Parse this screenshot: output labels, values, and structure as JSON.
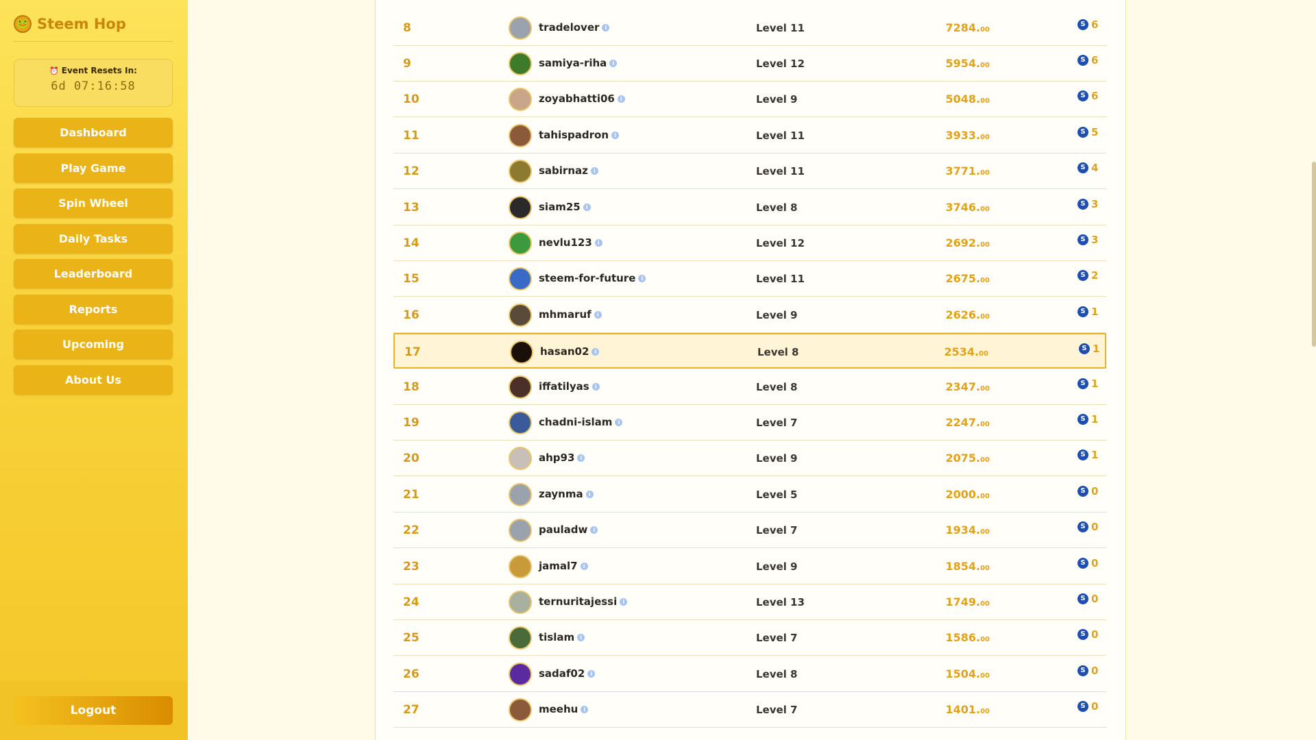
{
  "app": {
    "name": "Steem Hop"
  },
  "timer": {
    "label": "Event Resets In:",
    "value": "6d 07:16:58"
  },
  "nav": [
    {
      "label": "Dashboard"
    },
    {
      "label": "Play Game"
    },
    {
      "label": "Spin Wheel"
    },
    {
      "label": "Daily Tasks"
    },
    {
      "label": "Leaderboard"
    },
    {
      "label": "Reports"
    },
    {
      "label": "Upcoming"
    },
    {
      "label": "About Us"
    }
  ],
  "logout": "Logout",
  "leaderboard": {
    "rows": [
      {
        "rank": "8",
        "user": "tradelover",
        "level": "Level 11",
        "score": "7284.",
        "dec": "00",
        "steem": "6",
        "avatar": "#9aa3ad"
      },
      {
        "rank": "9",
        "user": "samiya-riha",
        "level": "Level 12",
        "score": "5954.",
        "dec": "00",
        "steem": "6",
        "avatar": "#3d7a2a"
      },
      {
        "rank": "10",
        "user": "zoyabhatti06",
        "level": "Level 9",
        "score": "5048.",
        "dec": "00",
        "steem": "6",
        "avatar": "#c9a58a"
      },
      {
        "rank": "11",
        "user": "tahispadron",
        "level": "Level 11",
        "score": "3933.",
        "dec": "00",
        "steem": "5",
        "avatar": "#8a5a3a"
      },
      {
        "rank": "12",
        "user": "sabirnaz",
        "level": "Level 11",
        "score": "3771.",
        "dec": "00",
        "steem": "4",
        "avatar": "#8b7a30"
      },
      {
        "rank": "13",
        "user": "siam25",
        "level": "Level 8",
        "score": "3746.",
        "dec": "00",
        "steem": "3",
        "avatar": "#2a2a2a"
      },
      {
        "rank": "14",
        "user": "nevlu123",
        "level": "Level 12",
        "score": "2692.",
        "dec": "00",
        "steem": "3",
        "avatar": "#3c9a3c"
      },
      {
        "rank": "15",
        "user": "steem-for-future",
        "level": "Level 11",
        "score": "2675.",
        "dec": "00",
        "steem": "2",
        "avatar": "#3a6ac8"
      },
      {
        "rank": "16",
        "user": "mhmaruf",
        "level": "Level 9",
        "score": "2626.",
        "dec": "00",
        "steem": "1",
        "avatar": "#5a4a3a"
      },
      {
        "rank": "17",
        "user": "hasan02",
        "level": "Level 8",
        "score": "2534.",
        "dec": "00",
        "steem": "1",
        "avatar": "#1a1008",
        "highlight": true
      },
      {
        "rank": "18",
        "user": "iffatilyas",
        "level": "Level 8",
        "score": "2347.",
        "dec": "00",
        "steem": "1",
        "avatar": "#4a3028"
      },
      {
        "rank": "19",
        "user": "chadni-islam",
        "level": "Level 7",
        "score": "2247.",
        "dec": "00",
        "steem": "1",
        "avatar": "#3a5a9a"
      },
      {
        "rank": "20",
        "user": "ahp93",
        "level": "Level 9",
        "score": "2075.",
        "dec": "00",
        "steem": "1",
        "avatar": "#c8c0b8"
      },
      {
        "rank": "21",
        "user": "zaynma",
        "level": "Level 5",
        "score": "2000.",
        "dec": "00",
        "steem": "0",
        "avatar": "#9aa3ad"
      },
      {
        "rank": "22",
        "user": "pauladw",
        "level": "Level 7",
        "score": "1934.",
        "dec": "00",
        "steem": "0",
        "avatar": "#9aa3ad"
      },
      {
        "rank": "23",
        "user": "jamal7",
        "level": "Level 9",
        "score": "1854.",
        "dec": "00",
        "steem": "0",
        "avatar": "#c89a3a"
      },
      {
        "rank": "24",
        "user": "ternuritajessi",
        "level": "Level 13",
        "score": "1749.",
        "dec": "00",
        "steem": "0",
        "avatar": "#a8b0a0"
      },
      {
        "rank": "25",
        "user": "tislam",
        "level": "Level 7",
        "score": "1586.",
        "dec": "00",
        "steem": "0",
        "avatar": "#4a6a3a"
      },
      {
        "rank": "26",
        "user": "sadaf02",
        "level": "Level 8",
        "score": "1504.",
        "dec": "00",
        "steem": "0",
        "avatar": "#5a2aa0"
      },
      {
        "rank": "27",
        "user": "meehu",
        "level": "Level 7",
        "score": "1401.",
        "dec": "00",
        "steem": "0",
        "avatar": "#8a5a3a"
      }
    ]
  }
}
